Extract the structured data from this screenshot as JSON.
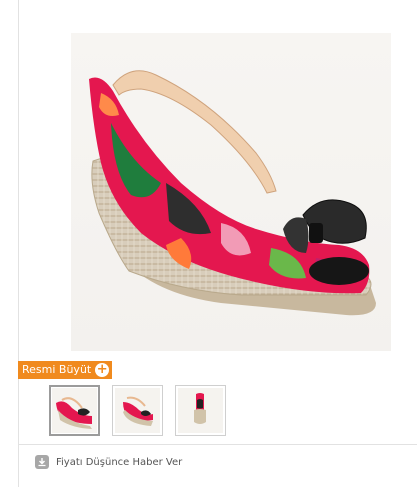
{
  "product": {
    "main_image_alt": "Floral print wedge slingback sandal with black bow",
    "zoom_label": "Resmi Büyüt",
    "zoom_icon": "plus-circle-icon",
    "thumbnails": [
      {
        "alt": "Sandal thumbnail front view",
        "selected": true
      },
      {
        "alt": "Sandal thumbnail side view",
        "selected": false
      },
      {
        "alt": "Sandal thumbnail back view",
        "selected": false
      }
    ],
    "notify_label": "Fiyatı Düşünce Haber Ver",
    "notify_icon": "download-arrow-icon"
  },
  "colors": {
    "accent": "#f08a1e",
    "divider": "#e2e2e2",
    "text": "#555555"
  }
}
